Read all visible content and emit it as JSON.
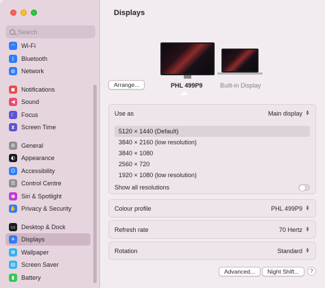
{
  "sidebar": {
    "search_placeholder": "Search",
    "items": [
      {
        "label": "Wi-Fi",
        "icon": "wifi-icon",
        "color": "#2f7cf6",
        "glyph": "◠"
      },
      {
        "label": "Bluetooth",
        "icon": "bluetooth-icon",
        "color": "#2f7cf6",
        "glyph": "ᛒ"
      },
      {
        "label": "Network",
        "icon": "network-icon",
        "color": "#2f7cf6",
        "glyph": "◍"
      },
      {
        "label": "Notifications",
        "icon": "notifications-icon",
        "color": "#ee4b4b",
        "glyph": "◼"
      },
      {
        "label": "Sound",
        "icon": "sound-icon",
        "color": "#ee4b6b",
        "glyph": "◀"
      },
      {
        "label": "Focus",
        "icon": "focus-icon",
        "color": "#5b55d6",
        "glyph": "☾"
      },
      {
        "label": "Screen Time",
        "icon": "screen-time-icon",
        "color": "#5b55d6",
        "glyph": "⧗"
      },
      {
        "label": "General",
        "icon": "general-icon",
        "color": "#8e8e93",
        "glyph": "⚙"
      },
      {
        "label": "Appearance",
        "icon": "appearance-icon",
        "color": "#1c1c1e",
        "glyph": "◐"
      },
      {
        "label": "Accessibility",
        "icon": "accessibility-icon",
        "color": "#2f7cf6",
        "glyph": "☺"
      },
      {
        "label": "Control Centre",
        "icon": "control-centre-icon",
        "color": "#8e8e93",
        "glyph": "☰"
      },
      {
        "label": "Siri & Spotlight",
        "icon": "siri-icon",
        "color": "#c03cd6",
        "glyph": "◉"
      },
      {
        "label": "Privacy & Security",
        "icon": "privacy-icon",
        "color": "#2f7cf6",
        "glyph": "✋"
      },
      {
        "label": "Desktop & Dock",
        "icon": "desktop-dock-icon",
        "color": "#1c1c1e",
        "glyph": "▭"
      },
      {
        "label": "Displays",
        "icon": "displays-icon",
        "color": "#2f7cf6",
        "glyph": "☀"
      },
      {
        "label": "Wallpaper",
        "icon": "wallpaper-icon",
        "color": "#35b3e8",
        "glyph": "✿"
      },
      {
        "label": "Screen Saver",
        "icon": "screen-saver-icon",
        "color": "#35b3e8",
        "glyph": "▤"
      },
      {
        "label": "Battery",
        "icon": "battery-icon",
        "color": "#34c759",
        "glyph": "▮"
      }
    ],
    "selected": "Displays"
  },
  "main": {
    "title": "Displays",
    "arrange_label": "Arrange...",
    "displays": [
      {
        "name": "PHL 499P9",
        "selected": true
      },
      {
        "name": "Built-in Display",
        "selected": false
      }
    ],
    "use_as": {
      "label": "Use as",
      "value": "Main display"
    },
    "resolutions": [
      "5120 × 1440 (Default)",
      "3840 × 2160 (low resolution)",
      "3840 × 1080",
      "2560 × 720",
      "1920 × 1080 (low resolution)"
    ],
    "selected_resolution": "5120 × 1440 (Default)",
    "show_all_resolutions": {
      "label": "Show all resolutions",
      "on": false
    },
    "colour_profile": {
      "label": "Colour profile",
      "value": "PHL 499P9"
    },
    "refresh_rate": {
      "label": "Refresh rate",
      "value": "70 Hertz"
    },
    "rotation": {
      "label": "Rotation",
      "value": "Standard"
    },
    "advanced_label": "Advanced...",
    "night_shift_label": "Night Shift...",
    "help_label": "?"
  }
}
